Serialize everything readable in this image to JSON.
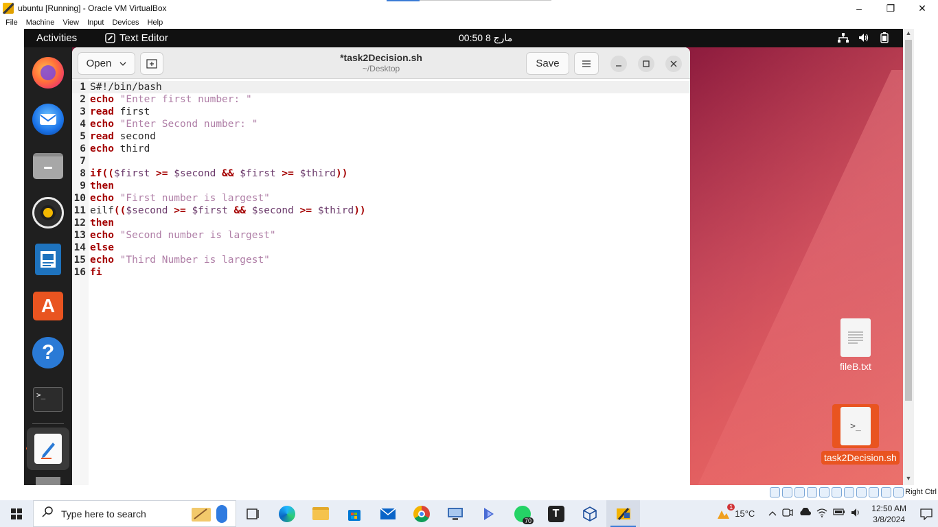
{
  "host_window": {
    "title": "ubuntu [Running] - Oracle VM VirtualBox",
    "controls": {
      "minimize": "–",
      "maximize": "❐",
      "close": "✕"
    }
  },
  "vbox_menu": [
    "File",
    "Machine",
    "View",
    "Input",
    "Devices",
    "Help"
  ],
  "ubuntu_topbar": {
    "activities": "Activities",
    "app_name": "Text Editor",
    "clock": "00:50 مارج 8"
  },
  "editor": {
    "open_label": "Open",
    "save_label": "Save",
    "doc_title": "*task2Decision.sh",
    "doc_path": "~/Desktop",
    "lines": [
      {
        "n": "1"
      },
      {
        "n": "2"
      },
      {
        "n": "3"
      },
      {
        "n": "4"
      },
      {
        "n": "5"
      },
      {
        "n": "6"
      },
      {
        "n": "7"
      },
      {
        "n": "8"
      },
      {
        "n": "9"
      },
      {
        "n": "10"
      },
      {
        "n": "11"
      },
      {
        "n": "12"
      },
      {
        "n": "13"
      },
      {
        "n": "14"
      },
      {
        "n": "15"
      },
      {
        "n": "16"
      }
    ],
    "code": {
      "l1": "S#!/bin/bash",
      "l2_kw": "echo",
      "l2_str": "\"Enter first number: \"",
      "l3_kw": "read",
      "l3_txt": "first",
      "l4_kw": "echo",
      "l4_str": "\"Enter Second number: \"",
      "l5_kw": "read",
      "l5_txt": "second",
      "l6_kw": "echo",
      "l6_txt": "third",
      "l8_a": "if((",
      "l8_b": "$first",
      "l8_c": ">=",
      "l8_d": "$second",
      "l8_e": "&&",
      "l8_f": "$first",
      "l8_g": ">=",
      "l8_h": "$third",
      "l8_i": "))",
      "l9": "then",
      "l10_kw": "echo",
      "l10_str": "\"First number is largest\"",
      "l11_a": "eilf",
      "l11_b": "((",
      "l11_c": "$second",
      "l11_d": ">=",
      "l11_e": "$first",
      "l11_f": "&&",
      "l11_g": "$second",
      "l11_h": ">=",
      "l11_i": "$third",
      "l11_j": "))",
      "l12": "then",
      "l13_kw": "echo",
      "l13_str": "\"Second number is largest\"",
      "l14": "else",
      "l15_kw": "echo",
      "l15_str": "\"Third Number is largest\"",
      "l16": "fi"
    }
  },
  "desktop_icons": [
    {
      "label": "fileB.txt"
    },
    {
      "label": "task2Decision.sh",
      "glyph": ">_"
    }
  ],
  "vbox_status": {
    "host_key": "Right Ctrl"
  },
  "taskbar": {
    "search_placeholder": "Type here to search",
    "whatsapp_badge": "70",
    "weather_badge": "1",
    "temperature": "15°C",
    "time": "12:50 AM",
    "date": "3/8/2024"
  },
  "colors": {
    "ubuntu_orange": "#e95420",
    "keyword": "#a40000",
    "string": "#b07fa7",
    "variable": "#6b3a6b"
  }
}
